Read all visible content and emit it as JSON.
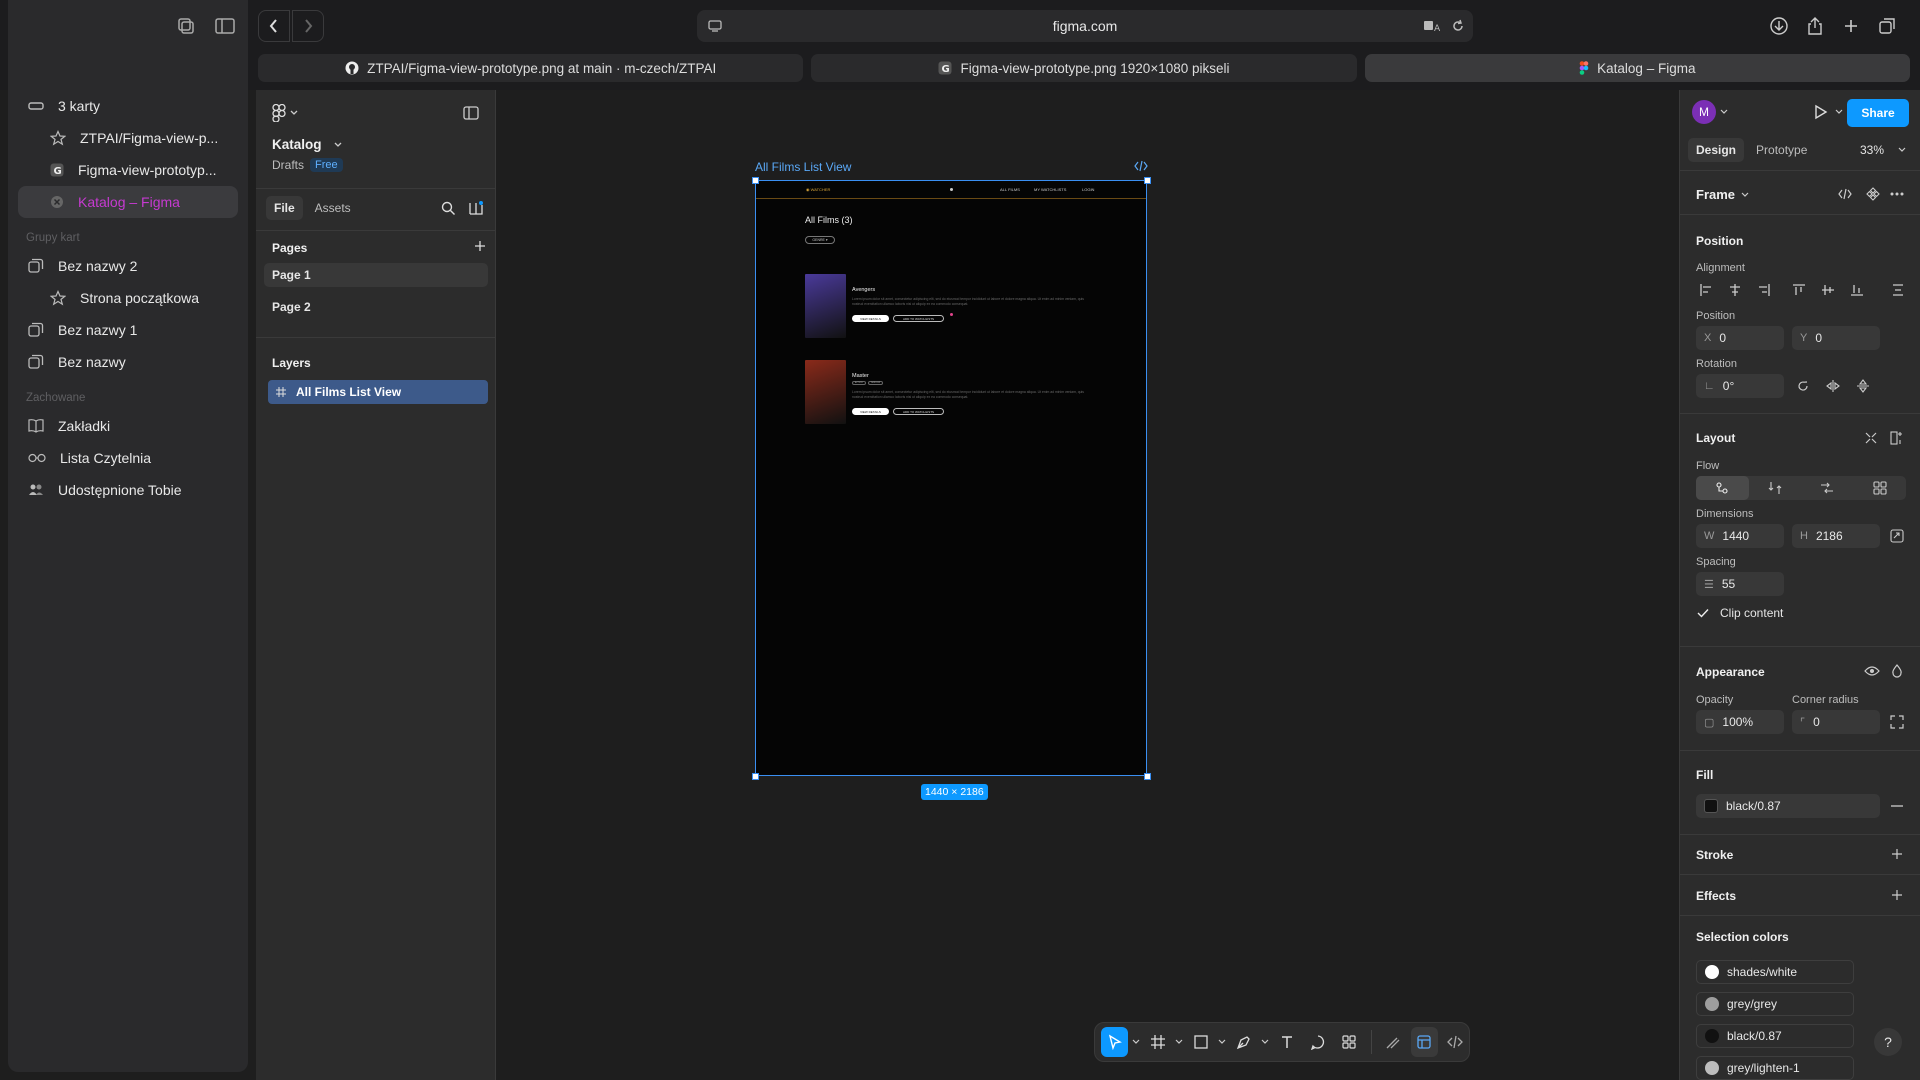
{
  "browser": {
    "url": "figma.com",
    "sidebar": {
      "tabs_label": "3 karty",
      "tabs": [
        {
          "label": "ZTPAI/Figma-view-p...",
          "icon": "star-icon"
        },
        {
          "label": "Figma-view-prototyp...",
          "icon": "g-icon"
        },
        {
          "label": "Katalog – Figma",
          "icon": "close-circle-icon"
        }
      ],
      "groups_header": "Grupy kart",
      "groups": [
        {
          "label": "Bez nazwy 2",
          "icon": "tabs-icon",
          "sub": false
        },
        {
          "label": "Strona początkowa",
          "icon": "star-icon",
          "sub": true
        },
        {
          "label": "Bez nazwy 1",
          "icon": "tabs-icon",
          "sub": false
        },
        {
          "label": "Bez nazwy",
          "icon": "tabs-icon",
          "sub": false
        }
      ],
      "saved_header": "Zachowane",
      "saved": [
        {
          "label": "Zakładki",
          "icon": "book-icon"
        },
        {
          "label": "Lista Czytelnia",
          "icon": "glasses-icon"
        },
        {
          "label": "Udostępnione Tobie",
          "icon": "shared-icon"
        }
      ]
    },
    "tabs": [
      {
        "label": "ZTPAI/Figma-view-prototype.png at main · m-czech/ZTPAI",
        "icon": "github-icon"
      },
      {
        "label": "Figma-view-prototype.png 1920×1080 pikseli",
        "icon": "g-icon"
      },
      {
        "label": "Katalog – Figma",
        "icon": "figma-icon"
      }
    ]
  },
  "figma": {
    "file_name": "Katalog",
    "drafts": "Drafts",
    "plan": "Free",
    "left_tabs": [
      "File",
      "Assets"
    ],
    "pages_header": "Pages",
    "pages": [
      "Page 1",
      "Page 2"
    ],
    "layers_header": "Layers",
    "layers": [
      "All Films List View"
    ],
    "frame_label": "All Films List View",
    "frame_size": "1440 × 2186",
    "avatar": "M",
    "share": "Share",
    "right_tabs": [
      "Design",
      "Prototype"
    ],
    "zoom": "33%",
    "frame_type": "Frame",
    "position_header": "Position",
    "alignment_label": "Alignment",
    "position_label": "Position",
    "x_key": "X",
    "x": "0",
    "y_key": "Y",
    "y": "0",
    "rotation_label": "Rotation",
    "rotation": "0°",
    "layout_header": "Layout",
    "flow_label": "Flow",
    "dimensions_label": "Dimensions",
    "w_key": "W",
    "w": "1440",
    "h_key": "H",
    "h": "2186",
    "spacing_label": "Spacing",
    "spacing": "55",
    "clip_content": "Clip content",
    "appearance_header": "Appearance",
    "opacity_label": "Opacity",
    "opacity": "100%",
    "corner_label": "Corner radius",
    "corner": "0",
    "fill_header": "Fill",
    "fill": "black/0.87",
    "stroke_header": "Stroke",
    "effects_header": "Effects",
    "selection_colors_header": "Selection colors",
    "selection_colors": [
      {
        "name": "shades/white",
        "color": "#ffffff"
      },
      {
        "name": "grey/grey",
        "color": "#9e9e9e"
      },
      {
        "name": "black/0.87",
        "color": "#111111"
      },
      {
        "name": "grey/lighten-1",
        "color": "#bdbdbd"
      }
    ],
    "help": "?"
  },
  "frame_content": {
    "brand": "WATCHER",
    "nav": [
      "ALL FILMS",
      "MY WATCHLISTS",
      "LOGIN"
    ],
    "title": "All Films (3)",
    "genre_button": "GENRE",
    "films": [
      {
        "title": "Avengers",
        "text": "Lorem ipsum dolor sit amet, consectetur adipiscing elit, sed do eiusmod tempor incididunt ut labore et dolore magna aliqua. Ut enim ad minim veniam, quis nostrud exercitation ullamco laboris nisi ut aliquip ex ea commodo consequat.",
        "tags": [],
        "btn1": "VIEW DETAILS",
        "btn2": "ADD TO WATCHLISTS",
        "poster": "#4a3a9a"
      },
      {
        "title": "Master",
        "text": "Lorem ipsum dolor sit amet, consectetur adipiscing elit, sed do eiusmod tempor incididunt ut labore et dolore magna aliqua. Ut enim ad minim veniam, quis nostrud exercitation ullamco laboris nisi ut aliquip ex ea commodo consequat.",
        "tags": [
          "ACTION",
          "THRILLER"
        ],
        "btn1": "VIEW DETAILS",
        "btn2": "ADD TO WATCHLISTS",
        "poster": "#8a2a1a"
      }
    ]
  },
  "colors": {
    "accent": "#0d99ff",
    "active_tab": "#c63ad1",
    "frame_stroke": "#3a8ff2"
  }
}
